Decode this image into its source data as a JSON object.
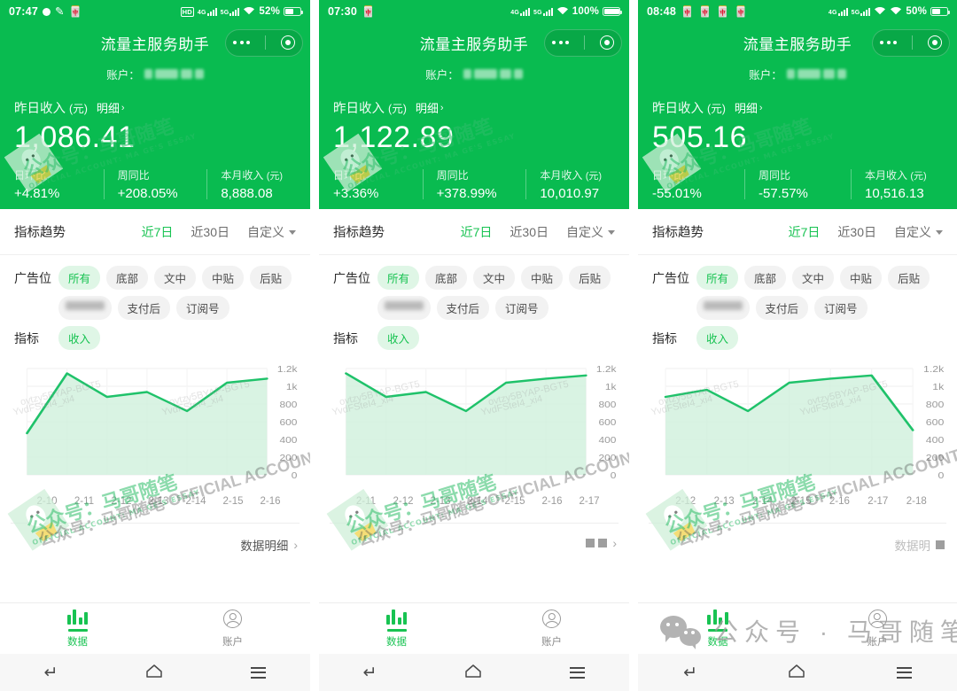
{
  "app": {
    "title": "流量主服务助手",
    "account_label": "账户：",
    "income_label": "昨日收入",
    "income_unit": "(元)",
    "detail_label": "明细",
    "chevron": "›",
    "kpi_day_label": "日环比",
    "kpi_week_label": "周同比",
    "kpi_month_label": "本月收入",
    "kpi_month_unit": "(元)",
    "trend_title": "指标趋势",
    "trend_tabs": [
      "近7日",
      "近30日",
      "自定义"
    ],
    "adslot_label": "广告位",
    "metric_label": "指标",
    "adslot_chips": [
      "所有",
      "底部",
      "文中",
      "中贴",
      "后贴",
      "插屏佣",
      "支付后",
      "订阅号"
    ],
    "metric_chips": [
      "收入"
    ],
    "data_detail_label": "数据明细",
    "tabbar": [
      {
        "label": "数据",
        "icon": "bar-chart-icon"
      },
      {
        "label": "账户",
        "icon": "user-icon"
      }
    ],
    "android_nav": [
      "back-icon",
      "home-icon",
      "recents-icon"
    ]
  },
  "colors": {
    "header_green": "#09BB50",
    "accent_green": "#18C352",
    "chip_active_bg": "#DFF6E6",
    "chart_line": "#1FC26A",
    "chart_fill": "#CFF0DC"
  },
  "watermark": {
    "main": "马哥随笔",
    "sub": "公众号：",
    "en1": "OFFICIAL ACCOUNT: MA GE'S ESSAY",
    "faint1": "ovtzy5BYAP-BGT5",
    "faint2": "YvdFSteI4_xi4",
    "bottom_text": "公众号 · 马哥随笔"
  },
  "panels": [
    {
      "id": "panel-1",
      "status": {
        "time": "07:47",
        "battery": "52%",
        "battery_pct": 52,
        "icons": [
          "dot-icon",
          "pen-icon",
          "emoji-icon"
        ],
        "right_icons": [
          "hd-icon",
          "4g-signal-icon",
          "5g-signal-icon",
          "wifi-icon"
        ]
      },
      "income": "1,086.41",
      "kpi_day": "+4.81%",
      "kpi_week": "+208.05%",
      "kpi_month": "8,888.08",
      "trend_active": 0,
      "chart_data": {
        "type": "area",
        "title": "指标趋势 - 收入",
        "categories": [
          "2-10",
          "2-11",
          "2-12",
          "2-13",
          "2-14",
          "2-15",
          "2-16"
        ],
        "values": [
          470,
          1145,
          880,
          935,
          720,
          1040,
          1086
        ],
        "ylabel": "",
        "xlabel": "",
        "ylim": [
          0,
          1200
        ],
        "yticks": [
          0,
          200,
          400,
          600,
          800,
          1000,
          1200
        ],
        "ytick_labels": [
          "0",
          "200",
          "400",
          "600",
          "800",
          "1k",
          "1.2k"
        ],
        "grid": true,
        "legend": "none"
      }
    },
    {
      "id": "panel-2",
      "status": {
        "time": "07:30",
        "battery": "100%",
        "battery_pct": 100,
        "icons": [
          "emoji-icon"
        ],
        "right_icons": [
          "4g-signal-icon",
          "5g-signal-icon",
          "wifi-icon"
        ]
      },
      "income": "1,122.89",
      "kpi_day": "+3.36%",
      "kpi_week": "+378.99%",
      "kpi_month": "10,010.97",
      "trend_active": 0,
      "chart_data": {
        "type": "area",
        "title": "指标趋势 - 收入",
        "categories": [
          "2-11",
          "2-12",
          "2-13",
          "2-14",
          "2-15",
          "2-16",
          "2-17"
        ],
        "values": [
          1145,
          880,
          935,
          720,
          1040,
          1086,
          1122
        ],
        "ylabel": "",
        "xlabel": "",
        "ylim": [
          0,
          1200
        ],
        "yticks": [
          0,
          200,
          400,
          600,
          800,
          1000,
          1200
        ],
        "ytick_labels": [
          "0",
          "200",
          "400",
          "600",
          "800",
          "1k",
          "1.2k"
        ],
        "grid": true,
        "legend": "none"
      }
    },
    {
      "id": "panel-3",
      "status": {
        "time": "08:48",
        "battery": "50%",
        "battery_pct": 50,
        "icons": [
          "emoji-icon",
          "emoji-icon",
          "emoji-icon",
          "emoji-icon"
        ],
        "right_icons": [
          "4g-signal-icon",
          "5g-signal-icon",
          "wifi-icon",
          "wifi-icon"
        ]
      },
      "income": "505.16",
      "kpi_day": "-55.01%",
      "kpi_week": "-57.57%",
      "kpi_month": "10,516.13",
      "trend_active": 0,
      "chart_data": {
        "type": "area",
        "title": "指标趋势 - 收入",
        "categories": [
          "2-12",
          "2-13",
          "2-14",
          "2-15",
          "2-16",
          "2-17",
          "2-18"
        ],
        "values": [
          880,
          960,
          720,
          1040,
          1086,
          1122,
          505
        ],
        "ylabel": "",
        "xlabel": "",
        "ylim": [
          0,
          1200
        ],
        "yticks": [
          0,
          200,
          400,
          600,
          800,
          1000,
          1200
        ],
        "ytick_labels": [
          "0",
          "200",
          "400",
          "600",
          "800",
          "1k",
          "1.2k"
        ],
        "grid": true,
        "legend": "none"
      }
    }
  ]
}
